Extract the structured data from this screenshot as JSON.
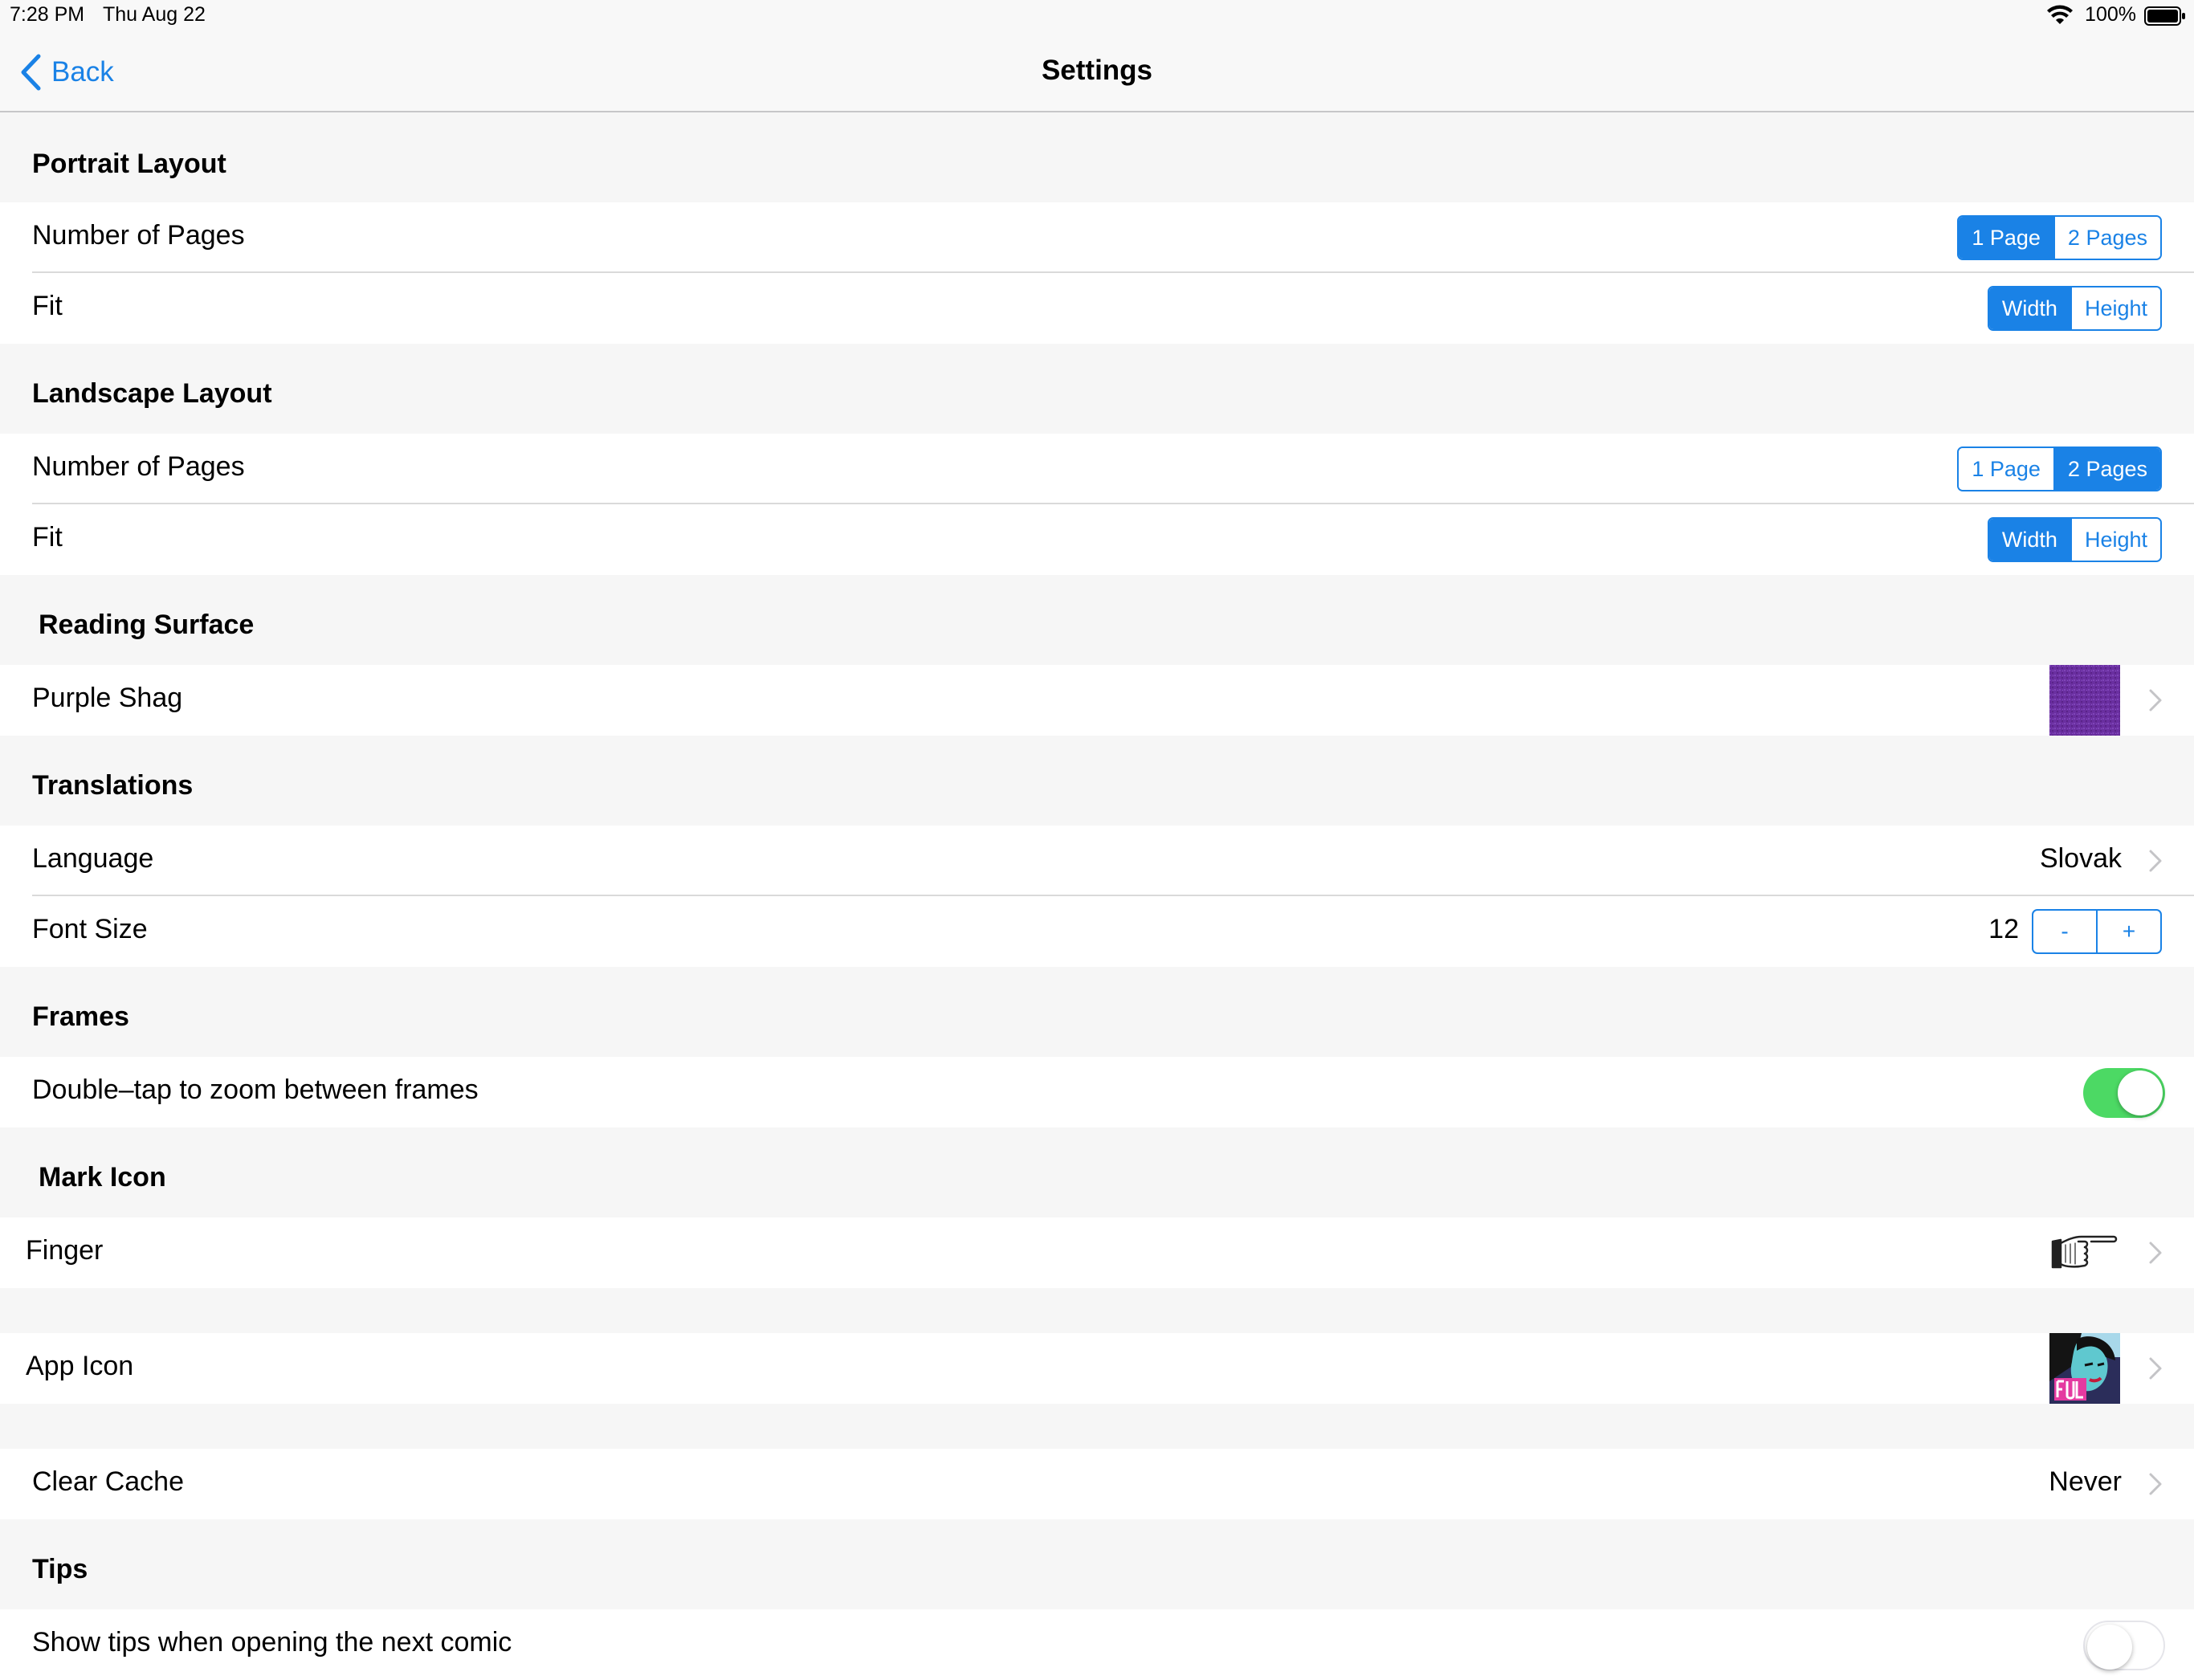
{
  "status": {
    "time": "7:28 PM",
    "date": "Thu Aug 22",
    "battery": "100%"
  },
  "nav": {
    "back_label": "Back",
    "title": "Settings"
  },
  "portrait": {
    "header": "Portrait Layout",
    "pages_label": "Number of Pages",
    "pages_options": [
      "1 Page",
      "2 Pages"
    ],
    "pages_selected": "1 Page",
    "fit_label": "Fit",
    "fit_options": [
      "Width",
      "Height"
    ],
    "fit_selected": "Width"
  },
  "landscape": {
    "header": "Landscape Layout",
    "pages_label": "Number of Pages",
    "pages_options": [
      "1 Page",
      "2 Pages"
    ],
    "pages_selected": "2 Pages",
    "fit_label": "Fit",
    "fit_options": [
      "Width",
      "Height"
    ],
    "fit_selected": "Width"
  },
  "reading_surface": {
    "header": "Reading Surface",
    "label": "Purple Shag",
    "swatch_color": "#6a2fa0"
  },
  "translations": {
    "header": "Translations",
    "language_label": "Language",
    "language_value": "Slovak",
    "font_size_label": "Font Size",
    "font_size_value": "12",
    "minus": "-",
    "plus": "+"
  },
  "frames": {
    "header": "Frames",
    "double_tap_label": "Double–tap to zoom between frames",
    "double_tap_on": true
  },
  "mark_icon": {
    "header": "Mark Icon",
    "label": "Finger"
  },
  "app_icon": {
    "label": "App Icon"
  },
  "cache": {
    "label": "Clear Cache",
    "value": "Never"
  },
  "tips": {
    "header": "Tips",
    "show_tips_label": "Show tips when opening the next comic",
    "show_tips_on": false
  },
  "colors": {
    "accent": "#1a82e6",
    "toggle_on": "#4cd964"
  }
}
